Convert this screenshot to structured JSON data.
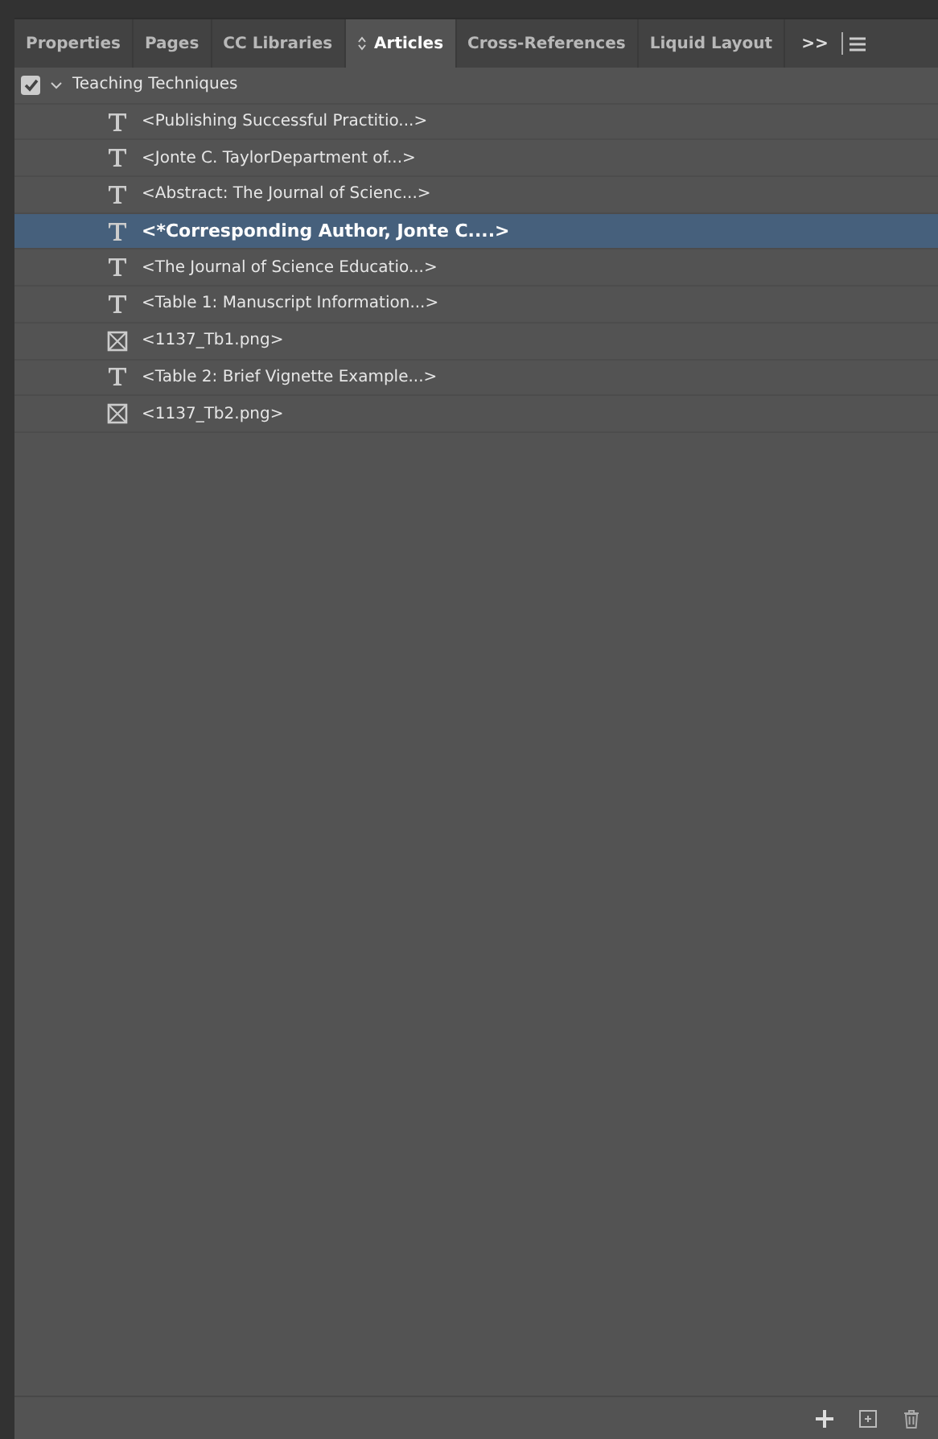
{
  "tabs": [
    {
      "label": "Properties",
      "selected": false
    },
    {
      "label": "Pages",
      "selected": false
    },
    {
      "label": "CC Libraries",
      "selected": false
    },
    {
      "label": "Articles",
      "selected": true
    },
    {
      "label": "Cross-References",
      "selected": false
    },
    {
      "label": "Liquid Layout",
      "selected": false
    }
  ],
  "overflow": ">>",
  "article": {
    "name": "Teaching Techniques",
    "checked": true,
    "expanded": true,
    "children": [
      {
        "kind": "text",
        "label": "<Publishing Successful Practitio...>",
        "selected": false
      },
      {
        "kind": "text",
        "label": "<Jonte C. TaylorDepartment of...>",
        "selected": false
      },
      {
        "kind": "text",
        "label": "<Abstract: The Journal of Scienc...>",
        "selected": false
      },
      {
        "kind": "text",
        "label": "<*Corresponding Author, Jonte C....>",
        "selected": true
      },
      {
        "kind": "text",
        "label": "<The Journal of Science Educatio...>",
        "selected": false
      },
      {
        "kind": "text",
        "label": "<Table 1: Manuscript Information...>",
        "selected": false
      },
      {
        "kind": "image",
        "label": "<1137_Tb1.png>",
        "selected": false
      },
      {
        "kind": "text",
        "label": "<Table 2: Brief Vignette Example...>",
        "selected": false
      },
      {
        "kind": "image",
        "label": "<1137_Tb2.png>",
        "selected": false
      }
    ]
  }
}
